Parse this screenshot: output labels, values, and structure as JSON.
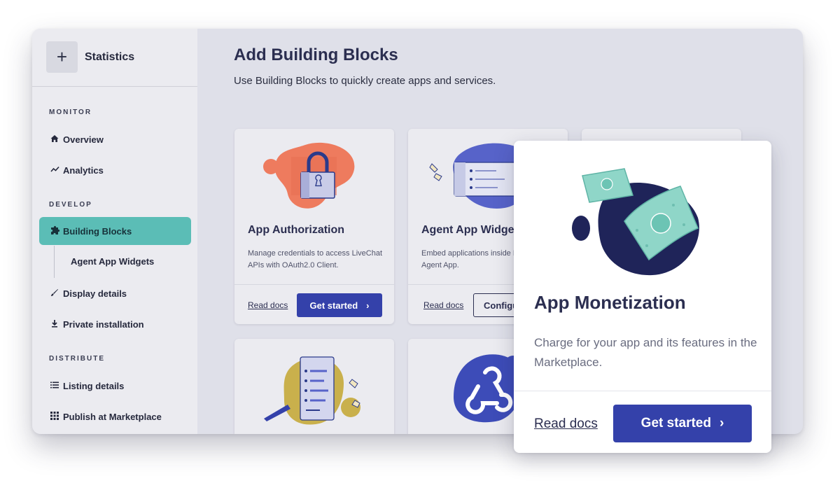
{
  "sidebar": {
    "header_title": "Statistics",
    "plus_glyph": "+",
    "sections": {
      "monitor": "MONITOR",
      "develop": "DEVELOP",
      "distribute": "DISTRIBUTE"
    },
    "items": {
      "overview": "Overview",
      "analytics": "Analytics",
      "building_blocks": "Building Blocks",
      "agent_app_widgets": "Agent App Widgets",
      "display_details": "Display details",
      "private_installation": "Private installation",
      "listing_details": "Listing details",
      "publish": "Publish at Marketplace"
    },
    "active_color": "#5bbdb6"
  },
  "main": {
    "title": "Add Building Blocks",
    "subtitle": "Use Building Blocks to quickly create apps and services."
  },
  "cards": [
    {
      "title": "App Authorization",
      "desc": "Manage credentials to access LiveChat APIs with OAuth2.0 Client.",
      "link": "Read docs",
      "button": "Get started",
      "icon": "lock-icon"
    },
    {
      "title": "Agent App Widgets",
      "desc": "Embed applications inside LiveChat Agent App.",
      "link": "Read docs",
      "button": "Configure",
      "icon": "widget-screen-icon"
    }
  ],
  "popup": {
    "title": "App Monetization",
    "desc": "Charge for your app and its features in the Marketplace.",
    "link": "Read docs",
    "button": "Get started",
    "icon": "money-icon"
  },
  "colors": {
    "primary": "#3441aa",
    "teal": "#5bbdb6",
    "coral": "#ee7b5e",
    "navy": "#1f2459",
    "mustard": "#c9b04c",
    "indigo": "#5763c9"
  }
}
